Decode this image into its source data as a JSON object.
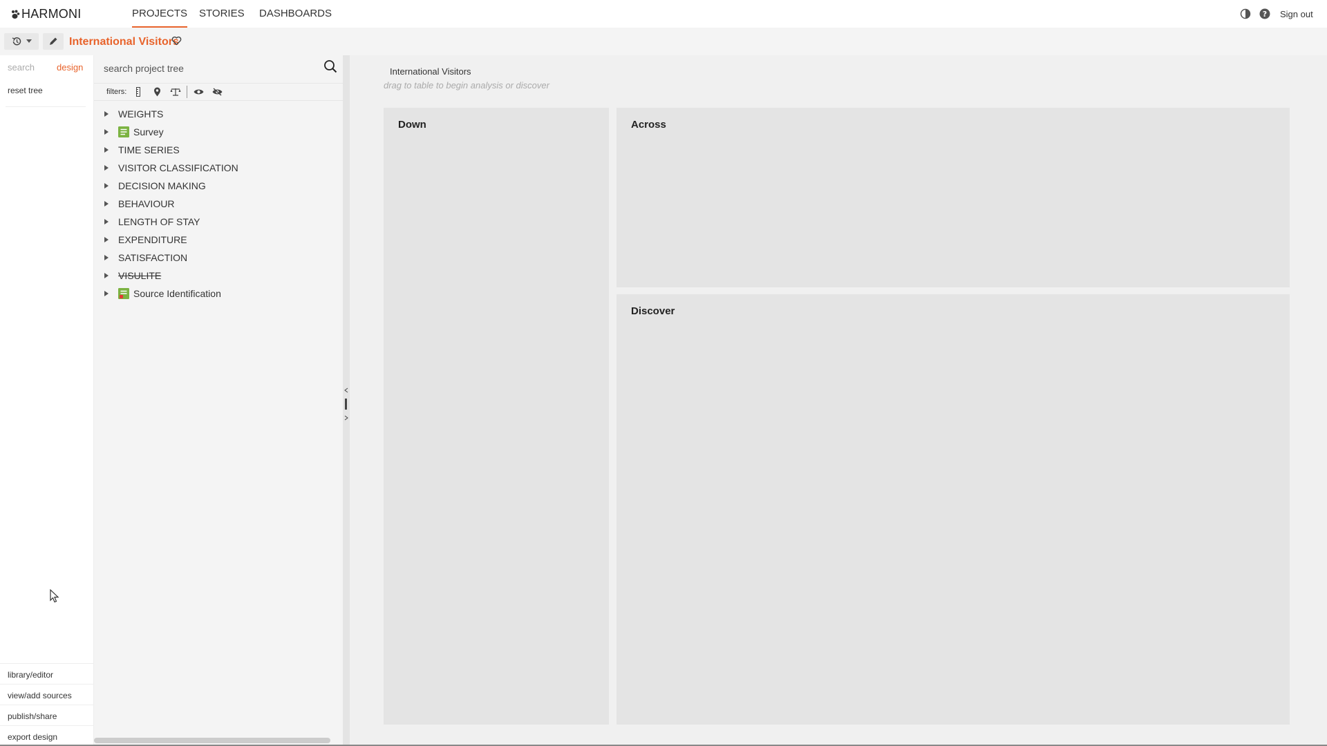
{
  "app": {
    "logo_text": "HARMONI",
    "accent_color": "#e8632b"
  },
  "topnav": {
    "tabs": [
      {
        "label": "PROJECTS",
        "active": true
      },
      {
        "label": "STORIES",
        "active": false
      },
      {
        "label": "DASHBOARDS",
        "active": false
      }
    ],
    "icons": [
      "contrast-icon",
      "help-icon"
    ],
    "signout_label": "Sign out"
  },
  "toolbar": {
    "project_title": "International Visitors",
    "history_icon": "history-icon",
    "edit_icon": "pencil-icon",
    "favorite_icon": "heart-icon"
  },
  "leftbar": {
    "tabs": [
      {
        "label": "search",
        "active": false
      },
      {
        "label": "design",
        "active": true
      }
    ],
    "reset_label": "reset tree",
    "bottom_links": [
      "library/editor",
      "view/add sources",
      "publish/share",
      "export design"
    ]
  },
  "tree": {
    "search_placeholder": "search project tree",
    "filters_label": "filters:",
    "filter_icons": [
      "ruler-icon",
      "map-pin-icon",
      "scale-icon",
      "eye-icon",
      "eye-off-icon"
    ],
    "items": [
      {
        "label": "WEIGHTS",
        "icon": "",
        "strikethrough": false
      },
      {
        "label": "Survey",
        "icon": "survey-icon",
        "strikethrough": false
      },
      {
        "label": "TIME SERIES",
        "icon": "",
        "strikethrough": false
      },
      {
        "label": "VISITOR CLASSIFICATION",
        "icon": "",
        "strikethrough": false
      },
      {
        "label": "DECISION MAKING",
        "icon": "",
        "strikethrough": false
      },
      {
        "label": "BEHAVIOUR",
        "icon": "",
        "strikethrough": false
      },
      {
        "label": "LENGTH OF STAY",
        "icon": "",
        "strikethrough": false
      },
      {
        "label": "EXPENDITURE",
        "icon": "",
        "strikethrough": false
      },
      {
        "label": "SATISFACTION",
        "icon": "",
        "strikethrough": false
      },
      {
        "label": "VISULITE",
        "icon": "",
        "strikethrough": true
      },
      {
        "label": "Source Identification",
        "icon": "source-icon",
        "strikethrough": false
      }
    ]
  },
  "main": {
    "title": "International Visitors",
    "hint": "drag to table to begin analysis or discover",
    "zones": {
      "down": "Down",
      "across": "Across",
      "discover": "Discover"
    }
  }
}
